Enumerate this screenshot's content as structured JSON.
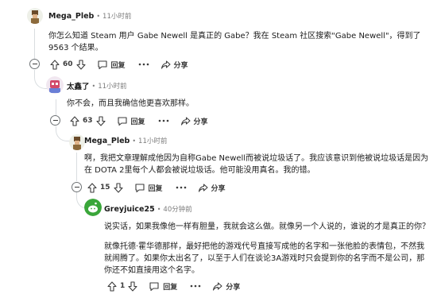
{
  "comments": [
    {
      "username": "Mega_Pleb",
      "time": "11小时前",
      "body": "你怎么知道 Steam 用户 Gabe Newell 是真正的 Gabe？我在 Steam 社区搜索\"Gabe Newell\"，得到了 9563 个结果。",
      "votes": "60",
      "reply_label": "回复",
      "share_label": "分享"
    },
    {
      "username": "太鑫了",
      "time": "11小时前",
      "body": "你不会，而且我确信他更喜欢那样。",
      "votes": "63",
      "reply_label": "回复",
      "share_label": "分享"
    },
    {
      "username": "Mega_Pleb",
      "time": "11小时前",
      "body": "啊，我把文章理解成他因为自称Gabe Newell而被说垃圾话了。我应该意识到他被说垃圾话是因为在 DOTA 2里每个人都会被说垃圾话。他可能没用真名。我的错。",
      "votes": "15",
      "reply_label": "回复",
      "share_label": "分享"
    },
    {
      "username": "Greyjuice25",
      "time": "40分钟前",
      "body1": "说实话，如果我像他一样有胆量，我就会这么做。就像另一个人说的，谁说的才是真正的你？",
      "body2": "就像托德·霍华德那样，最好把他的游戏代号直接写成他的名字和一张他脸的表情包，不然我就闹腾了。如果你太出名了，以至于人们在谈论3A游戏时只会提到你的名字而不是公司，那你还不如直接用这个名字。",
      "votes": "1",
      "reply_label": "回复",
      "share_label": "分享"
    }
  ],
  "colors": {
    "thread_line": "#d9dde0",
    "meta_text": "#7c7c7c",
    "action_text": "#3c3c3c",
    "avatar_green": "#3aa63a"
  },
  "icons": [
    "upvote-icon",
    "downvote-icon",
    "comment-bubble-icon",
    "ellipsis-icon",
    "share-icon",
    "collapse-icon"
  ]
}
